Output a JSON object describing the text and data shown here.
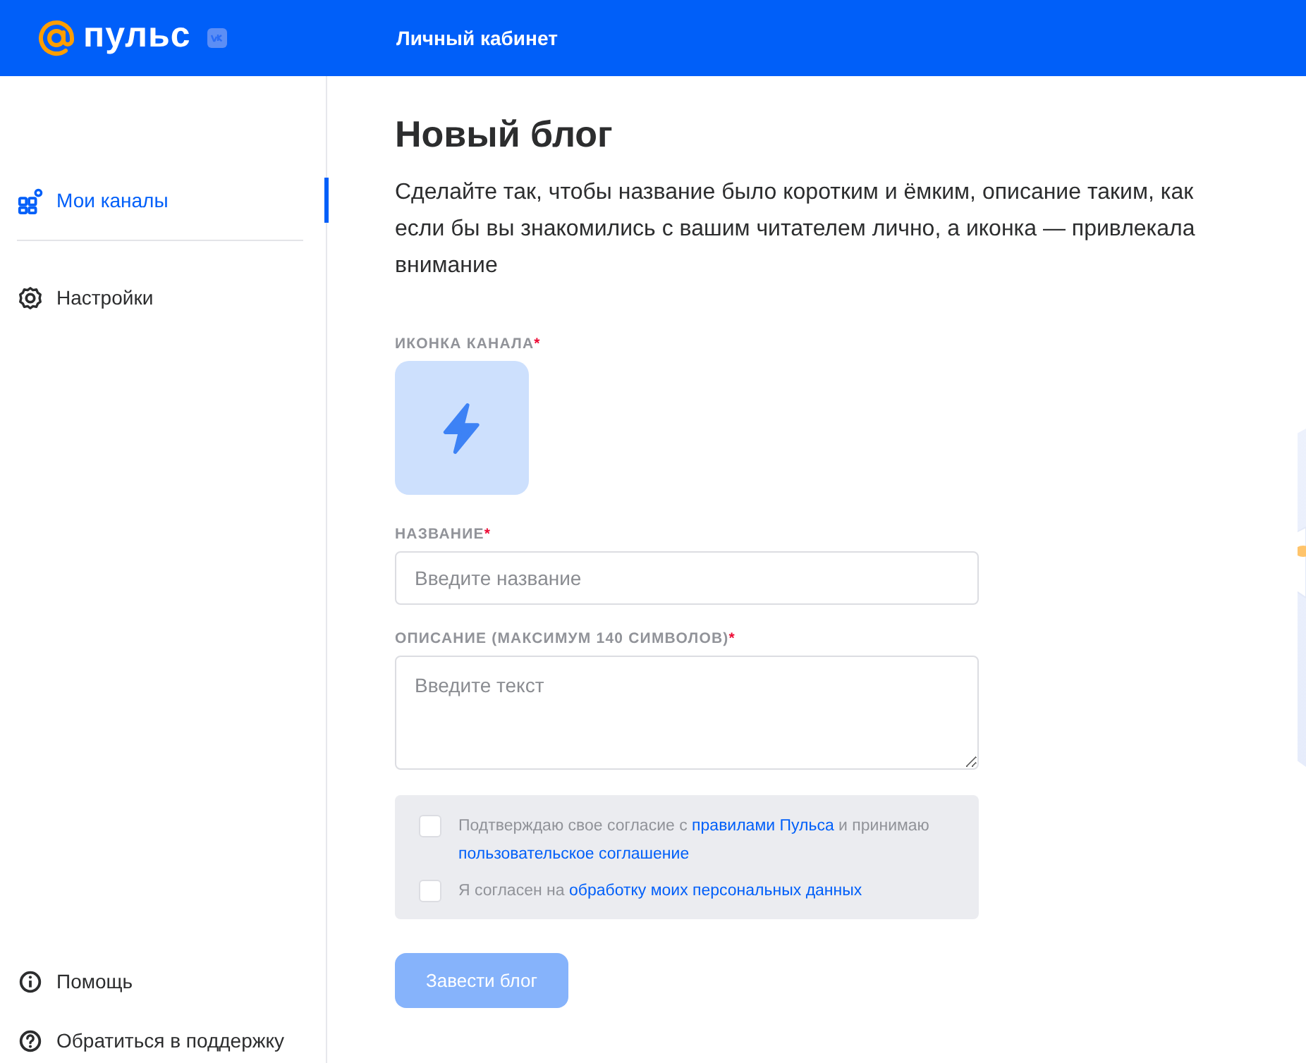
{
  "header": {
    "logo": "пульс",
    "title": "Личный кабинет"
  },
  "sidebar": {
    "items": [
      {
        "kind": "channels",
        "label": "Мои каналы",
        "selected": true
      },
      {
        "kind": "settings",
        "label": "Настройки",
        "selected": false
      }
    ],
    "footer_items": [
      {
        "kind": "info",
        "label": "Помощь"
      },
      {
        "kind": "question",
        "label": "Обратиться в поддержку"
      }
    ]
  },
  "main": {
    "title": "Новый блог",
    "intro": "Сделайте так, чтобы название было коротким и ёмким, описание таким, как если бы вы знакомились с вашим читателем лично, а иконка — привлекала внимание",
    "icon_field": {
      "label": "ИКОНКА КАНАЛА",
      "mark": "*"
    },
    "fields": [
      {
        "kind": "input",
        "label": "НАЗВАНИЕ",
        "mark": "*",
        "placeholder": "Введите название"
      },
      {
        "kind": "textarea",
        "label": "ОПИСАНИЕ (МАКСИМУМ 140 СИМВОЛОВ)",
        "mark": "*",
        "placeholder": "Введите текст"
      }
    ],
    "consents": [
      {
        "checked": false,
        "segments": [
          {
            "kind": "text",
            "text": "Подтверждаю свое согласие с"
          },
          {
            "kind": "link",
            "text": "правилами Пульса"
          },
          {
            "kind": "text",
            "text": "и принимаю"
          },
          {
            "kind": "link",
            "text": "пользовательское соглашение"
          }
        ]
      },
      {
        "checked": false,
        "segments": [
          {
            "kind": "text",
            "text": "Я согласен на"
          },
          {
            "kind": "link",
            "text": "обработку моих персональных данных"
          }
        ]
      }
    ],
    "submit": {
      "label": "Завести блог",
      "disabled": true
    }
  }
}
